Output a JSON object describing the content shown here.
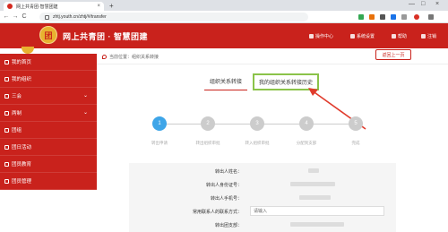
{
  "browser": {
    "tab_title": "网上共青团·智慧团建",
    "tab_close": "×",
    "new_tab": "+",
    "url": "zhtj.youth.cn/zhtj/#/transfer",
    "nav_back": "←",
    "nav_forward": "→",
    "nav_reload": "C",
    "min": "—",
    "max": "□",
    "close": "×"
  },
  "header": {
    "logo_text": "团",
    "site_name": "网上共青团 · 智慧团建",
    "nav": [
      "操作中心",
      "系统设置",
      "帮助",
      "注销"
    ]
  },
  "sidebar": {
    "items": [
      {
        "label": "我的首页",
        "chevron": ""
      },
      {
        "label": "我的组织",
        "chevron": ""
      },
      {
        "label": "三会",
        "chevron": "⌄"
      },
      {
        "label": "两制",
        "chevron": "⌄"
      },
      {
        "label": "团组",
        "chevron": ""
      },
      {
        "label": "团日活动",
        "chevron": ""
      },
      {
        "label": "团员教育",
        "chevron": ""
      },
      {
        "label": "团员管理",
        "chevron": ""
      }
    ]
  },
  "main": {
    "breadcrumb": "组织关系转接",
    "breadcrumb_prefix": "当前位置：",
    "back_button": "返回上一页",
    "tabs": [
      "组织关系转接",
      "我的组织关系转接历史"
    ],
    "steps": [
      {
        "num": "1",
        "label": "转出申请"
      },
      {
        "num": "2",
        "label": "转出组织审批"
      },
      {
        "num": "3",
        "label": "转入组织审批"
      },
      {
        "num": "4",
        "label": "分配到支部"
      },
      {
        "num": "5",
        "label": "完成"
      }
    ],
    "form": {
      "fields": [
        {
          "label": "转出人姓名："
        },
        {
          "label": "转出人身份证号："
        },
        {
          "label": "转出人手机号："
        },
        {
          "label": "常用联系人的联系方式：",
          "placeholder": "请输入"
        },
        {
          "label": "转出团支部："
        }
      ]
    }
  }
}
